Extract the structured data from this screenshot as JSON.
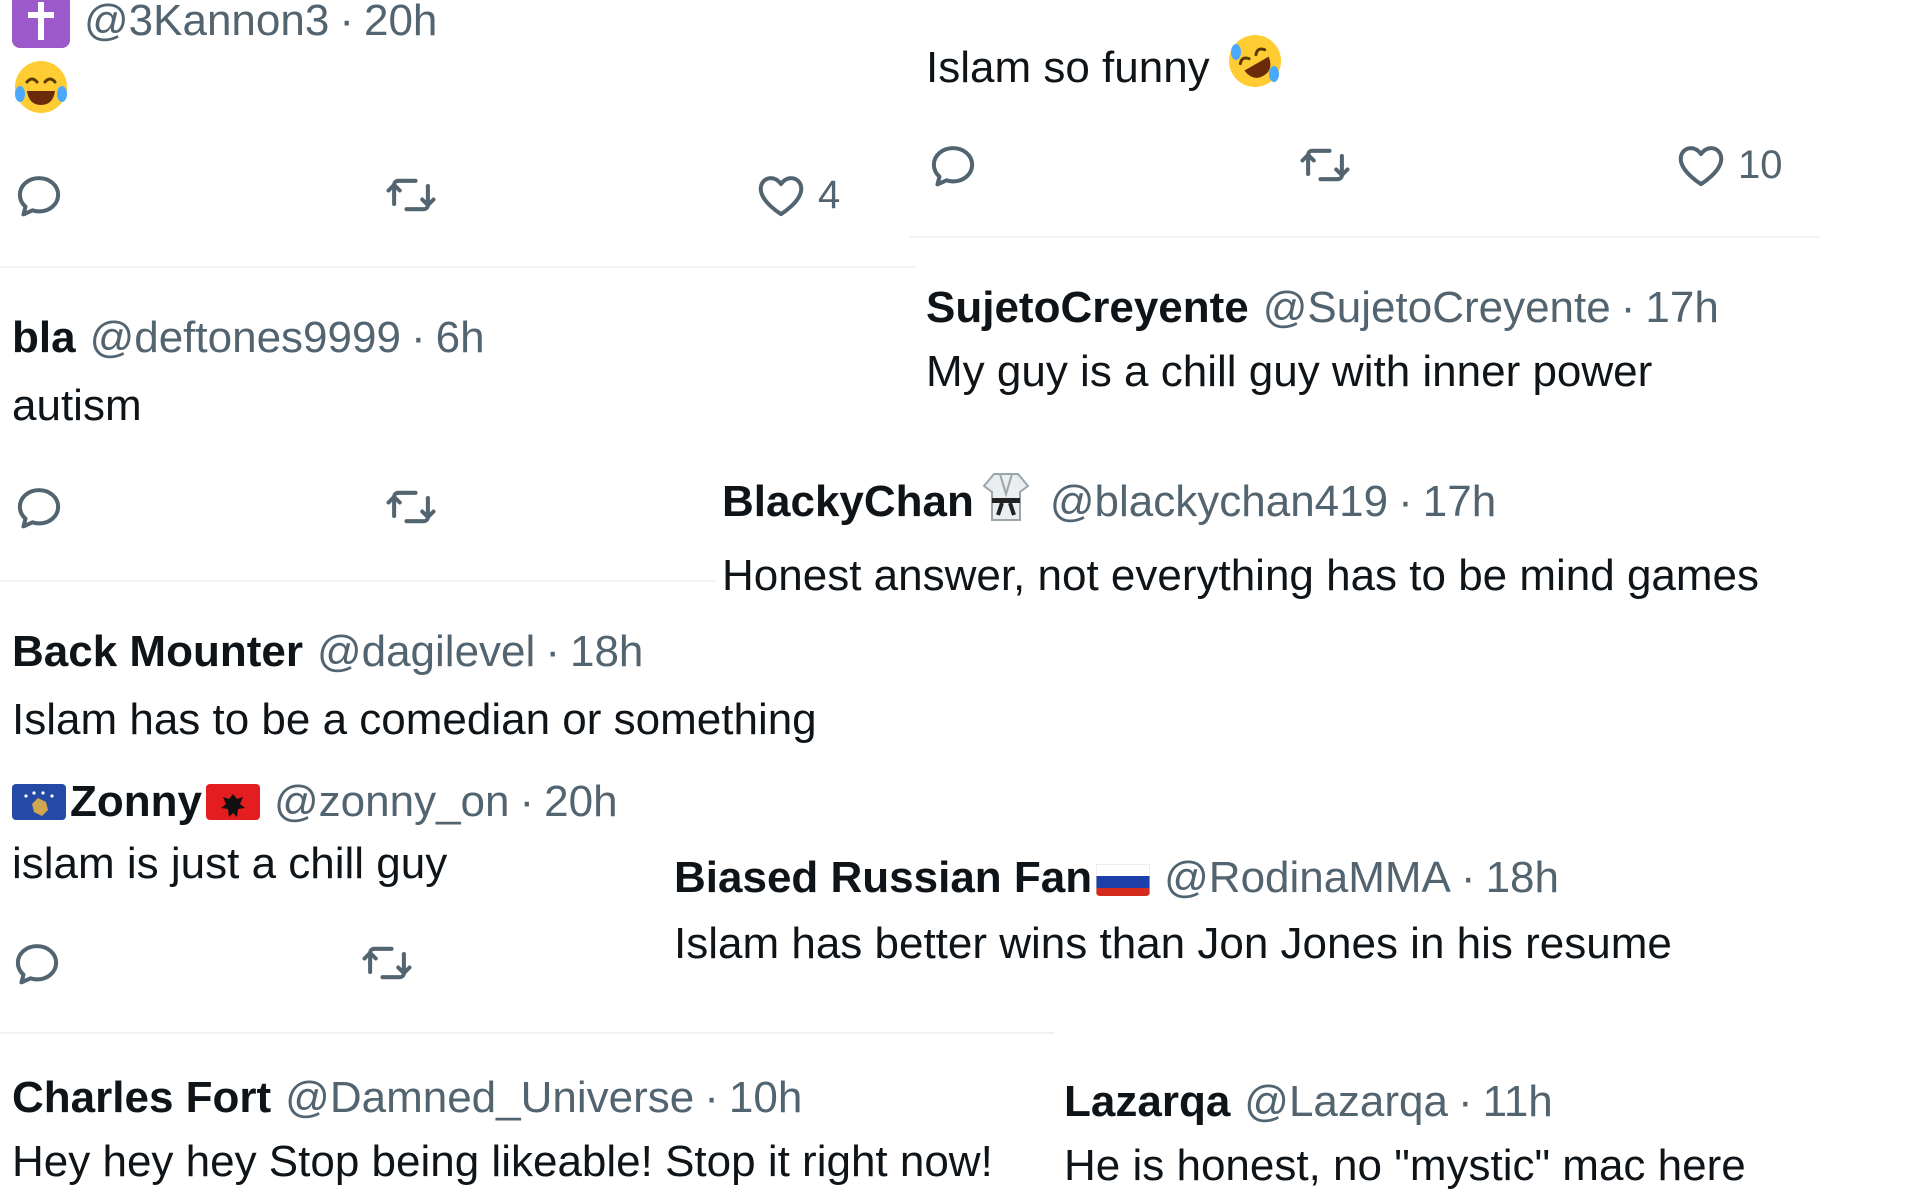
{
  "posts": {
    "kannon": {
      "handle": "@3Kannon3",
      "sep": "·",
      "time": "20h",
      "reply_emoji": "joy-emoji",
      "like_count": "4",
      "avatar_icon": "cross-icon"
    },
    "islam_funny": {
      "text": "Islam so funny",
      "emoji": "rofl-emoji",
      "like_count": "10"
    },
    "bla": {
      "name": "bla",
      "handle": "@deftones9999",
      "sep": "·",
      "time": "6h",
      "text": "autism"
    },
    "sujeto": {
      "name": "SujetoCreyente",
      "handle": "@SujetoCreyente",
      "sep": "·",
      "time": "17h",
      "text": "My guy is a chill guy with inner power"
    },
    "blacky": {
      "name": "BlackyChan",
      "badge": "judo-gi-emoji",
      "handle": "@blackychan419",
      "sep": "·",
      "time": "17h",
      "text": "Honest answer, not everything has to be mind games"
    },
    "back": {
      "name": "Back Mounter",
      "handle": "@dagilevel",
      "sep": "·",
      "time": "18h",
      "text": "Islam has to be a comedian or something"
    },
    "zonny": {
      "name": "Zonny",
      "flag_left": "kosovo-flag",
      "flag_right": "albania-flag",
      "handle": "@zonny_on",
      "sep": "·",
      "time": "20h",
      "text": "islam is just a chill guy"
    },
    "biased": {
      "name": "Biased Russian Fan",
      "flag": "russia-flag",
      "handle": "@RodinaMMA",
      "sep": "·",
      "time": "18h",
      "text": "Islam has better wins than Jon Jones in his resume"
    },
    "charles": {
      "name": "Charles Fort",
      "handle": "@Damned_Universe",
      "sep": "·",
      "time": "10h",
      "text": "Hey hey hey Stop being likeable! Stop it right now!"
    },
    "lazarqa": {
      "name": "Lazarqa",
      "handle": "@Lazarqa",
      "sep": "·",
      "time": "11h",
      "text": "He is honest, no \"mystic\" mac here"
    }
  },
  "icons": {
    "reply": "reply-icon",
    "retweet": "retweet-icon",
    "like": "heart-icon"
  },
  "colors": {
    "name": "#0f1419",
    "meta": "#536471",
    "separator": "#eff3f4",
    "cross_badge": "#9b59c9",
    "kosovo_blue": "#244aa5",
    "albania_red": "#e41e20"
  }
}
